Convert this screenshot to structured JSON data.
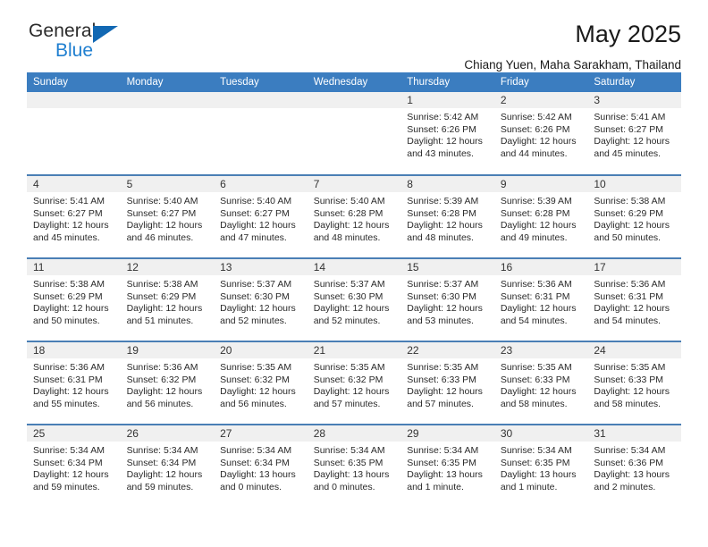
{
  "brand": {
    "name_top": "General",
    "name_bottom": "Blue"
  },
  "header": {
    "title": "May 2025",
    "subtitle": "Chiang Yuen, Maha Sarakham, Thailand"
  },
  "colors": {
    "header_blue": "#3b7dc0",
    "row_divider": "#4a7fb5",
    "daynum_band": "#f0f0f0",
    "brand_blue": "#1268b3"
  },
  "weekdays": [
    "Sunday",
    "Monday",
    "Tuesday",
    "Wednesday",
    "Thursday",
    "Friday",
    "Saturday"
  ],
  "weeks": [
    [
      {
        "day": "",
        "empty": true
      },
      {
        "day": "",
        "empty": true
      },
      {
        "day": "",
        "empty": true
      },
      {
        "day": "",
        "empty": true
      },
      {
        "day": "1",
        "sunrise": "Sunrise: 5:42 AM",
        "sunset": "Sunset: 6:26 PM",
        "daylight1": "Daylight: 12 hours",
        "daylight2": "and 43 minutes."
      },
      {
        "day": "2",
        "sunrise": "Sunrise: 5:42 AM",
        "sunset": "Sunset: 6:26 PM",
        "daylight1": "Daylight: 12 hours",
        "daylight2": "and 44 minutes."
      },
      {
        "day": "3",
        "sunrise": "Sunrise: 5:41 AM",
        "sunset": "Sunset: 6:27 PM",
        "daylight1": "Daylight: 12 hours",
        "daylight2": "and 45 minutes."
      }
    ],
    [
      {
        "day": "4",
        "sunrise": "Sunrise: 5:41 AM",
        "sunset": "Sunset: 6:27 PM",
        "daylight1": "Daylight: 12 hours",
        "daylight2": "and 45 minutes."
      },
      {
        "day": "5",
        "sunrise": "Sunrise: 5:40 AM",
        "sunset": "Sunset: 6:27 PM",
        "daylight1": "Daylight: 12 hours",
        "daylight2": "and 46 minutes."
      },
      {
        "day": "6",
        "sunrise": "Sunrise: 5:40 AM",
        "sunset": "Sunset: 6:27 PM",
        "daylight1": "Daylight: 12 hours",
        "daylight2": "and 47 minutes."
      },
      {
        "day": "7",
        "sunrise": "Sunrise: 5:40 AM",
        "sunset": "Sunset: 6:28 PM",
        "daylight1": "Daylight: 12 hours",
        "daylight2": "and 48 minutes."
      },
      {
        "day": "8",
        "sunrise": "Sunrise: 5:39 AM",
        "sunset": "Sunset: 6:28 PM",
        "daylight1": "Daylight: 12 hours",
        "daylight2": "and 48 minutes."
      },
      {
        "day": "9",
        "sunrise": "Sunrise: 5:39 AM",
        "sunset": "Sunset: 6:28 PM",
        "daylight1": "Daylight: 12 hours",
        "daylight2": "and 49 minutes."
      },
      {
        "day": "10",
        "sunrise": "Sunrise: 5:38 AM",
        "sunset": "Sunset: 6:29 PM",
        "daylight1": "Daylight: 12 hours",
        "daylight2": "and 50 minutes."
      }
    ],
    [
      {
        "day": "11",
        "sunrise": "Sunrise: 5:38 AM",
        "sunset": "Sunset: 6:29 PM",
        "daylight1": "Daylight: 12 hours",
        "daylight2": "and 50 minutes."
      },
      {
        "day": "12",
        "sunrise": "Sunrise: 5:38 AM",
        "sunset": "Sunset: 6:29 PM",
        "daylight1": "Daylight: 12 hours",
        "daylight2": "and 51 minutes."
      },
      {
        "day": "13",
        "sunrise": "Sunrise: 5:37 AM",
        "sunset": "Sunset: 6:30 PM",
        "daylight1": "Daylight: 12 hours",
        "daylight2": "and 52 minutes."
      },
      {
        "day": "14",
        "sunrise": "Sunrise: 5:37 AM",
        "sunset": "Sunset: 6:30 PM",
        "daylight1": "Daylight: 12 hours",
        "daylight2": "and 52 minutes."
      },
      {
        "day": "15",
        "sunrise": "Sunrise: 5:37 AM",
        "sunset": "Sunset: 6:30 PM",
        "daylight1": "Daylight: 12 hours",
        "daylight2": "and 53 minutes."
      },
      {
        "day": "16",
        "sunrise": "Sunrise: 5:36 AM",
        "sunset": "Sunset: 6:31 PM",
        "daylight1": "Daylight: 12 hours",
        "daylight2": "and 54 minutes."
      },
      {
        "day": "17",
        "sunrise": "Sunrise: 5:36 AM",
        "sunset": "Sunset: 6:31 PM",
        "daylight1": "Daylight: 12 hours",
        "daylight2": "and 54 minutes."
      }
    ],
    [
      {
        "day": "18",
        "sunrise": "Sunrise: 5:36 AM",
        "sunset": "Sunset: 6:31 PM",
        "daylight1": "Daylight: 12 hours",
        "daylight2": "and 55 minutes."
      },
      {
        "day": "19",
        "sunrise": "Sunrise: 5:36 AM",
        "sunset": "Sunset: 6:32 PM",
        "daylight1": "Daylight: 12 hours",
        "daylight2": "and 56 minutes."
      },
      {
        "day": "20",
        "sunrise": "Sunrise: 5:35 AM",
        "sunset": "Sunset: 6:32 PM",
        "daylight1": "Daylight: 12 hours",
        "daylight2": "and 56 minutes."
      },
      {
        "day": "21",
        "sunrise": "Sunrise: 5:35 AM",
        "sunset": "Sunset: 6:32 PM",
        "daylight1": "Daylight: 12 hours",
        "daylight2": "and 57 minutes."
      },
      {
        "day": "22",
        "sunrise": "Sunrise: 5:35 AM",
        "sunset": "Sunset: 6:33 PM",
        "daylight1": "Daylight: 12 hours",
        "daylight2": "and 57 minutes."
      },
      {
        "day": "23",
        "sunrise": "Sunrise: 5:35 AM",
        "sunset": "Sunset: 6:33 PM",
        "daylight1": "Daylight: 12 hours",
        "daylight2": "and 58 minutes."
      },
      {
        "day": "24",
        "sunrise": "Sunrise: 5:35 AM",
        "sunset": "Sunset: 6:33 PM",
        "daylight1": "Daylight: 12 hours",
        "daylight2": "and 58 minutes."
      }
    ],
    [
      {
        "day": "25",
        "sunrise": "Sunrise: 5:34 AM",
        "sunset": "Sunset: 6:34 PM",
        "daylight1": "Daylight: 12 hours",
        "daylight2": "and 59 minutes."
      },
      {
        "day": "26",
        "sunrise": "Sunrise: 5:34 AM",
        "sunset": "Sunset: 6:34 PM",
        "daylight1": "Daylight: 12 hours",
        "daylight2": "and 59 minutes."
      },
      {
        "day": "27",
        "sunrise": "Sunrise: 5:34 AM",
        "sunset": "Sunset: 6:34 PM",
        "daylight1": "Daylight: 13 hours",
        "daylight2": "and 0 minutes."
      },
      {
        "day": "28",
        "sunrise": "Sunrise: 5:34 AM",
        "sunset": "Sunset: 6:35 PM",
        "daylight1": "Daylight: 13 hours",
        "daylight2": "and 0 minutes."
      },
      {
        "day": "29",
        "sunrise": "Sunrise: 5:34 AM",
        "sunset": "Sunset: 6:35 PM",
        "daylight1": "Daylight: 13 hours",
        "daylight2": "and 1 minute."
      },
      {
        "day": "30",
        "sunrise": "Sunrise: 5:34 AM",
        "sunset": "Sunset: 6:35 PM",
        "daylight1": "Daylight: 13 hours",
        "daylight2": "and 1 minute."
      },
      {
        "day": "31",
        "sunrise": "Sunrise: 5:34 AM",
        "sunset": "Sunset: 6:36 PM",
        "daylight1": "Daylight: 13 hours",
        "daylight2": "and 2 minutes."
      }
    ]
  ]
}
